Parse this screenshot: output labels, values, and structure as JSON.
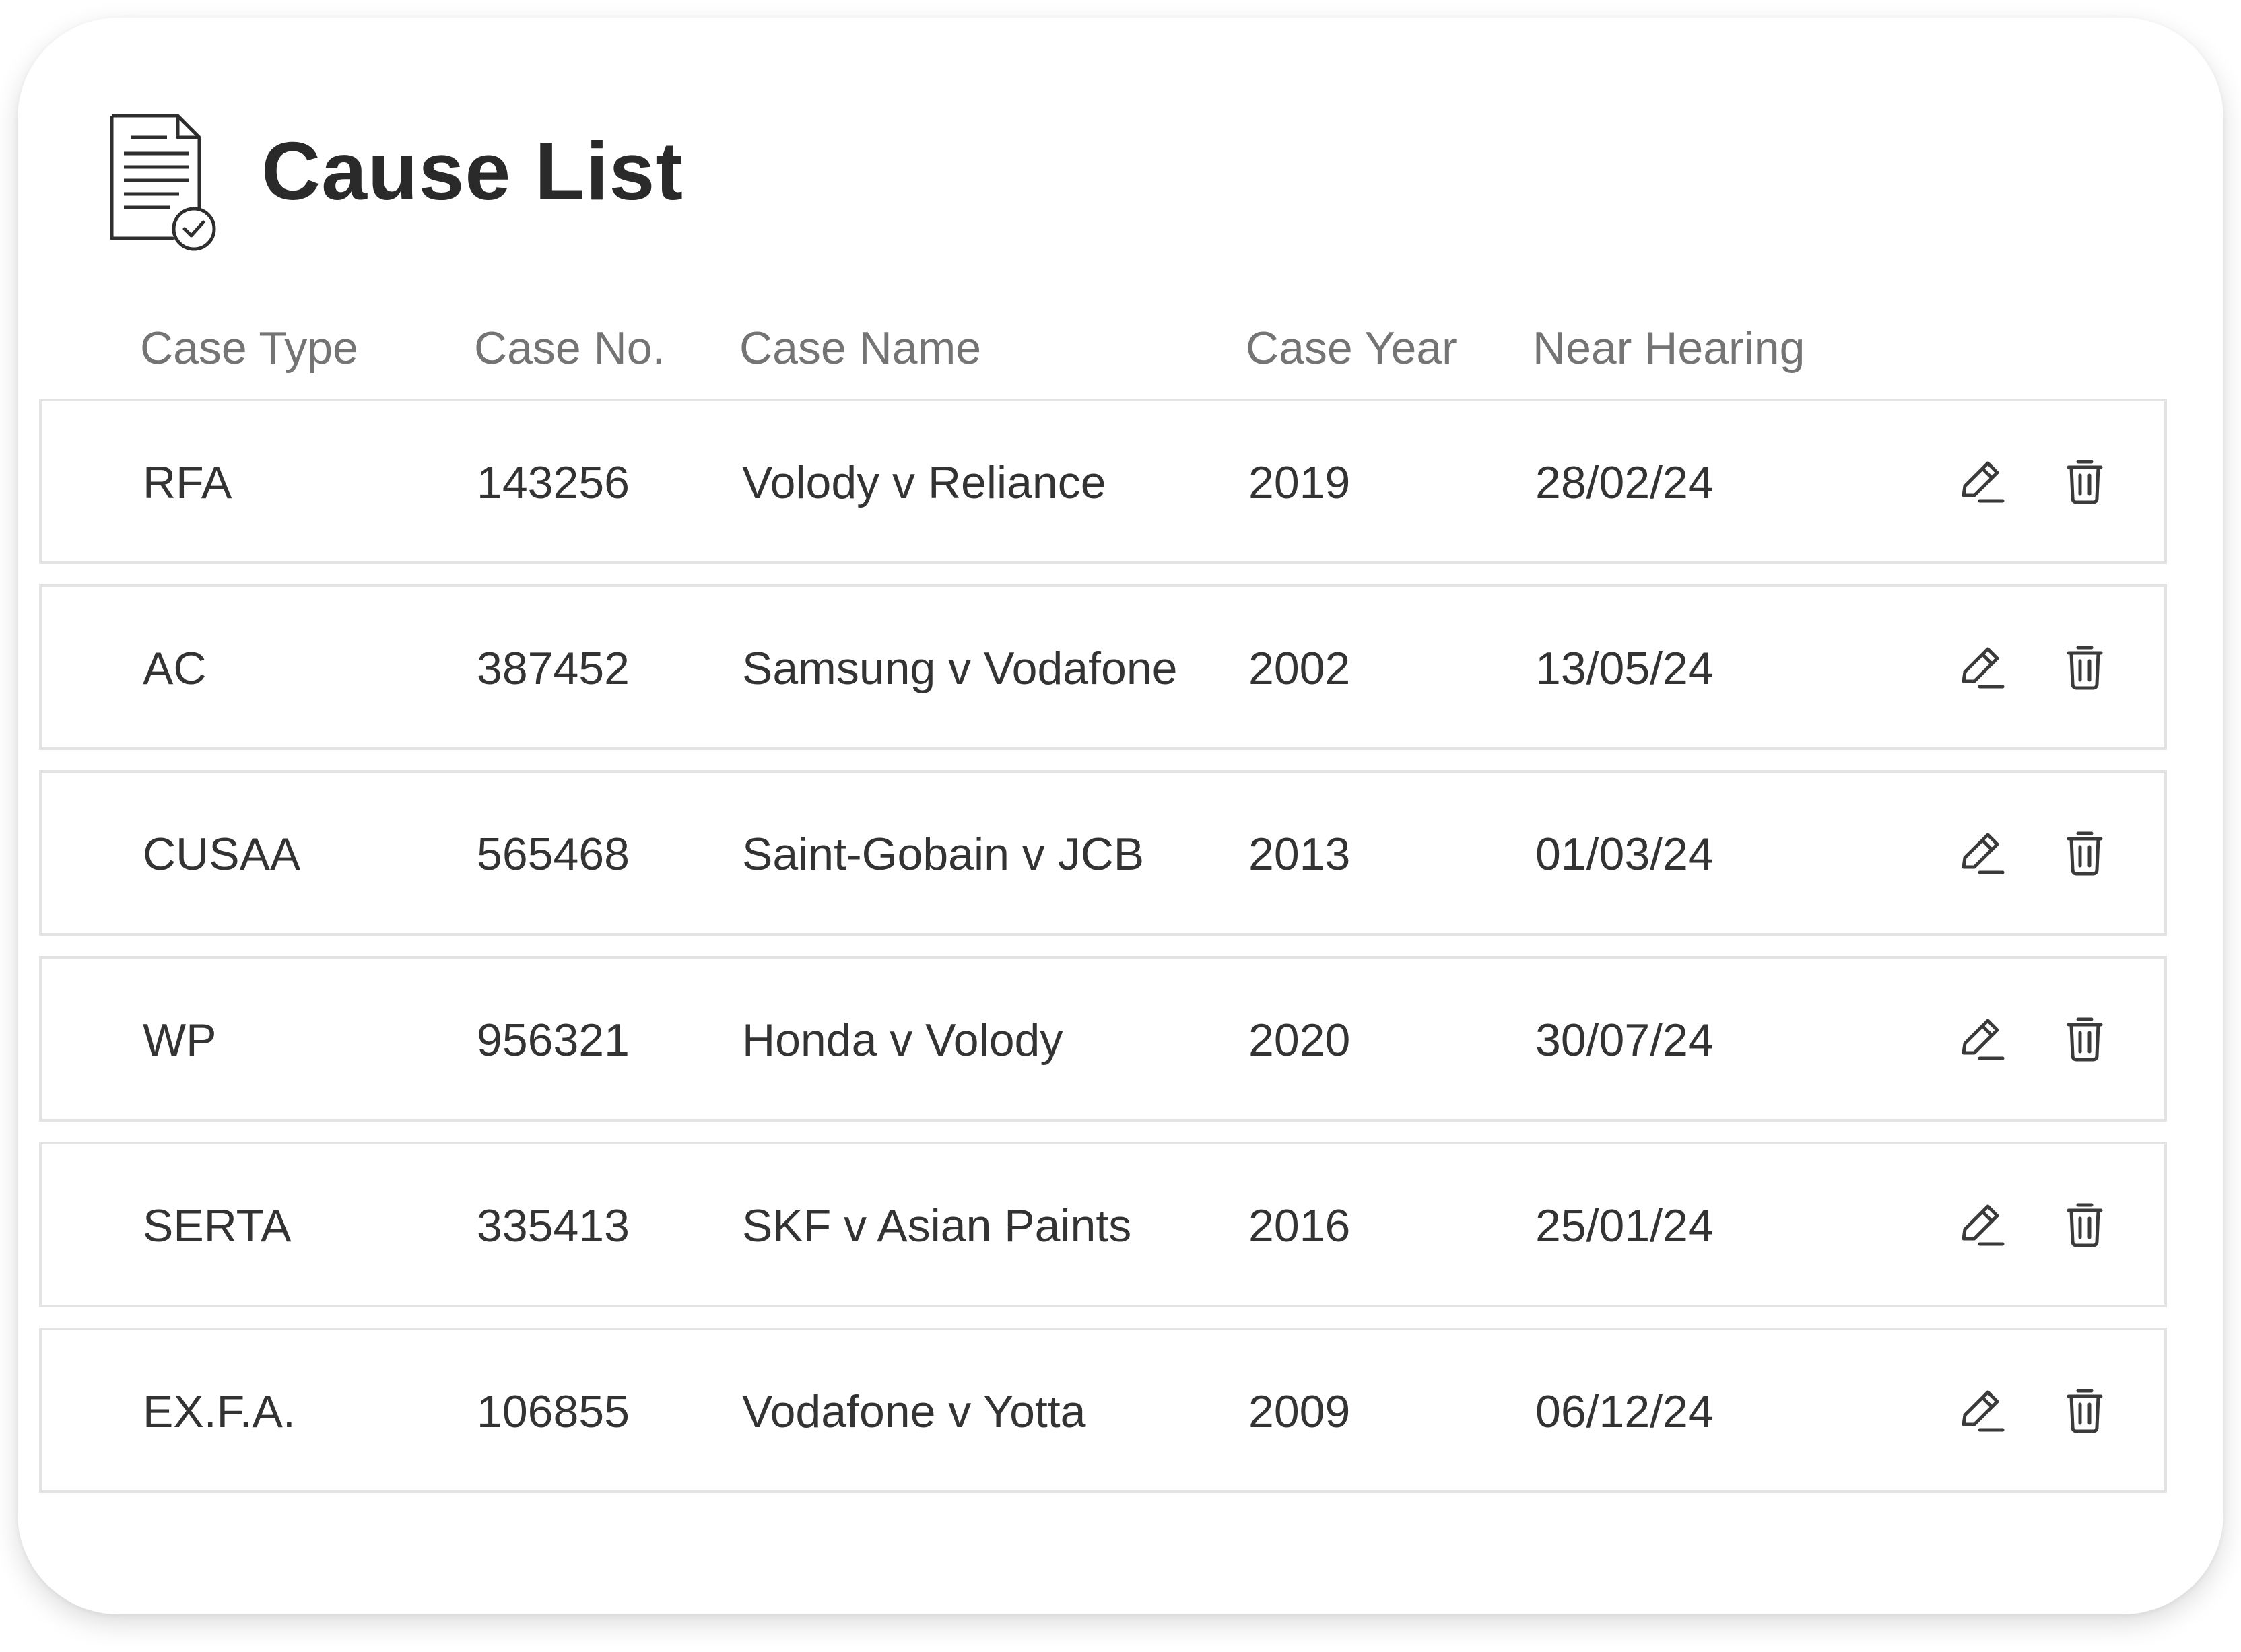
{
  "page": {
    "title": "Cause List",
    "title_icon": "document-check-icon"
  },
  "table": {
    "columns": [
      "Case Type",
      "Case No.",
      "Case Name",
      "Case Year",
      "Near Hearing"
    ],
    "rows": [
      {
        "case_type": "RFA",
        "case_no": "143256",
        "case_name": "Volody v Reliance",
        "case_year": "2019",
        "near_hearing": "28/02/24"
      },
      {
        "case_type": "AC",
        "case_no": "387452",
        "case_name": "Samsung v Vodafone",
        "case_year": "2002",
        "near_hearing": "13/05/24"
      },
      {
        "case_type": "CUSAA",
        "case_no": "565468",
        "case_name": "Saint-Gobain v JCB",
        "case_year": "2013",
        "near_hearing": "01/03/24"
      },
      {
        "case_type": "WP",
        "case_no": "956321",
        "case_name": "Honda v Volody",
        "case_year": "2020",
        "near_hearing": "30/07/24"
      },
      {
        "case_type": "SERTA",
        "case_no": "335413",
        "case_name": "SKF v Asian Paints",
        "case_year": "2016",
        "near_hearing": "25/01/24"
      },
      {
        "case_type": "EX.F.A.",
        "case_no": "106855",
        "case_name": "Vodafone v Yotta",
        "case_year": "2009",
        "near_hearing": "06/12/24"
      }
    ],
    "row_actions": [
      "pencil-icon",
      "trash-icon"
    ]
  },
  "colors": {
    "title_text": "#2a2a2a",
    "header_text": "#747474",
    "cell_text": "#333333",
    "row_border": "#e3e3e3",
    "icon_stroke": "#3a3a3a"
  }
}
